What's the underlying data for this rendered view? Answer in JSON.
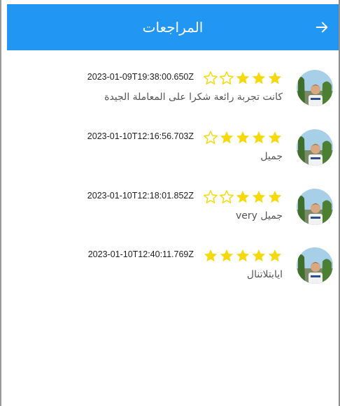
{
  "header": {
    "title": "المراجعات",
    "back_icon": "arrow-forward-icon"
  },
  "colors": {
    "accent": "#2196f3",
    "star_filled": "#f5d90a",
    "star_empty": "#f5d90a"
  },
  "reviews": [
    {
      "timestamp": "2023-01-09T19:38:00.650Z",
      "rating": 3,
      "max_rating": 5,
      "comment": "كانت تجربة رائعة شكرا على المعاملة الجيدة"
    },
    {
      "timestamp": "2023-01-10T12:16:56.703Z",
      "rating": 4,
      "max_rating": 5,
      "comment": "جميل"
    },
    {
      "timestamp": "2023-01-10T12:18:01.852Z",
      "rating": 3,
      "max_rating": 5,
      "comment": "جميل very"
    },
    {
      "timestamp": "2023-01-10T12:40:11.769Z",
      "rating": 5,
      "max_rating": 5,
      "comment": "ايابتلاتنال"
    }
  ]
}
